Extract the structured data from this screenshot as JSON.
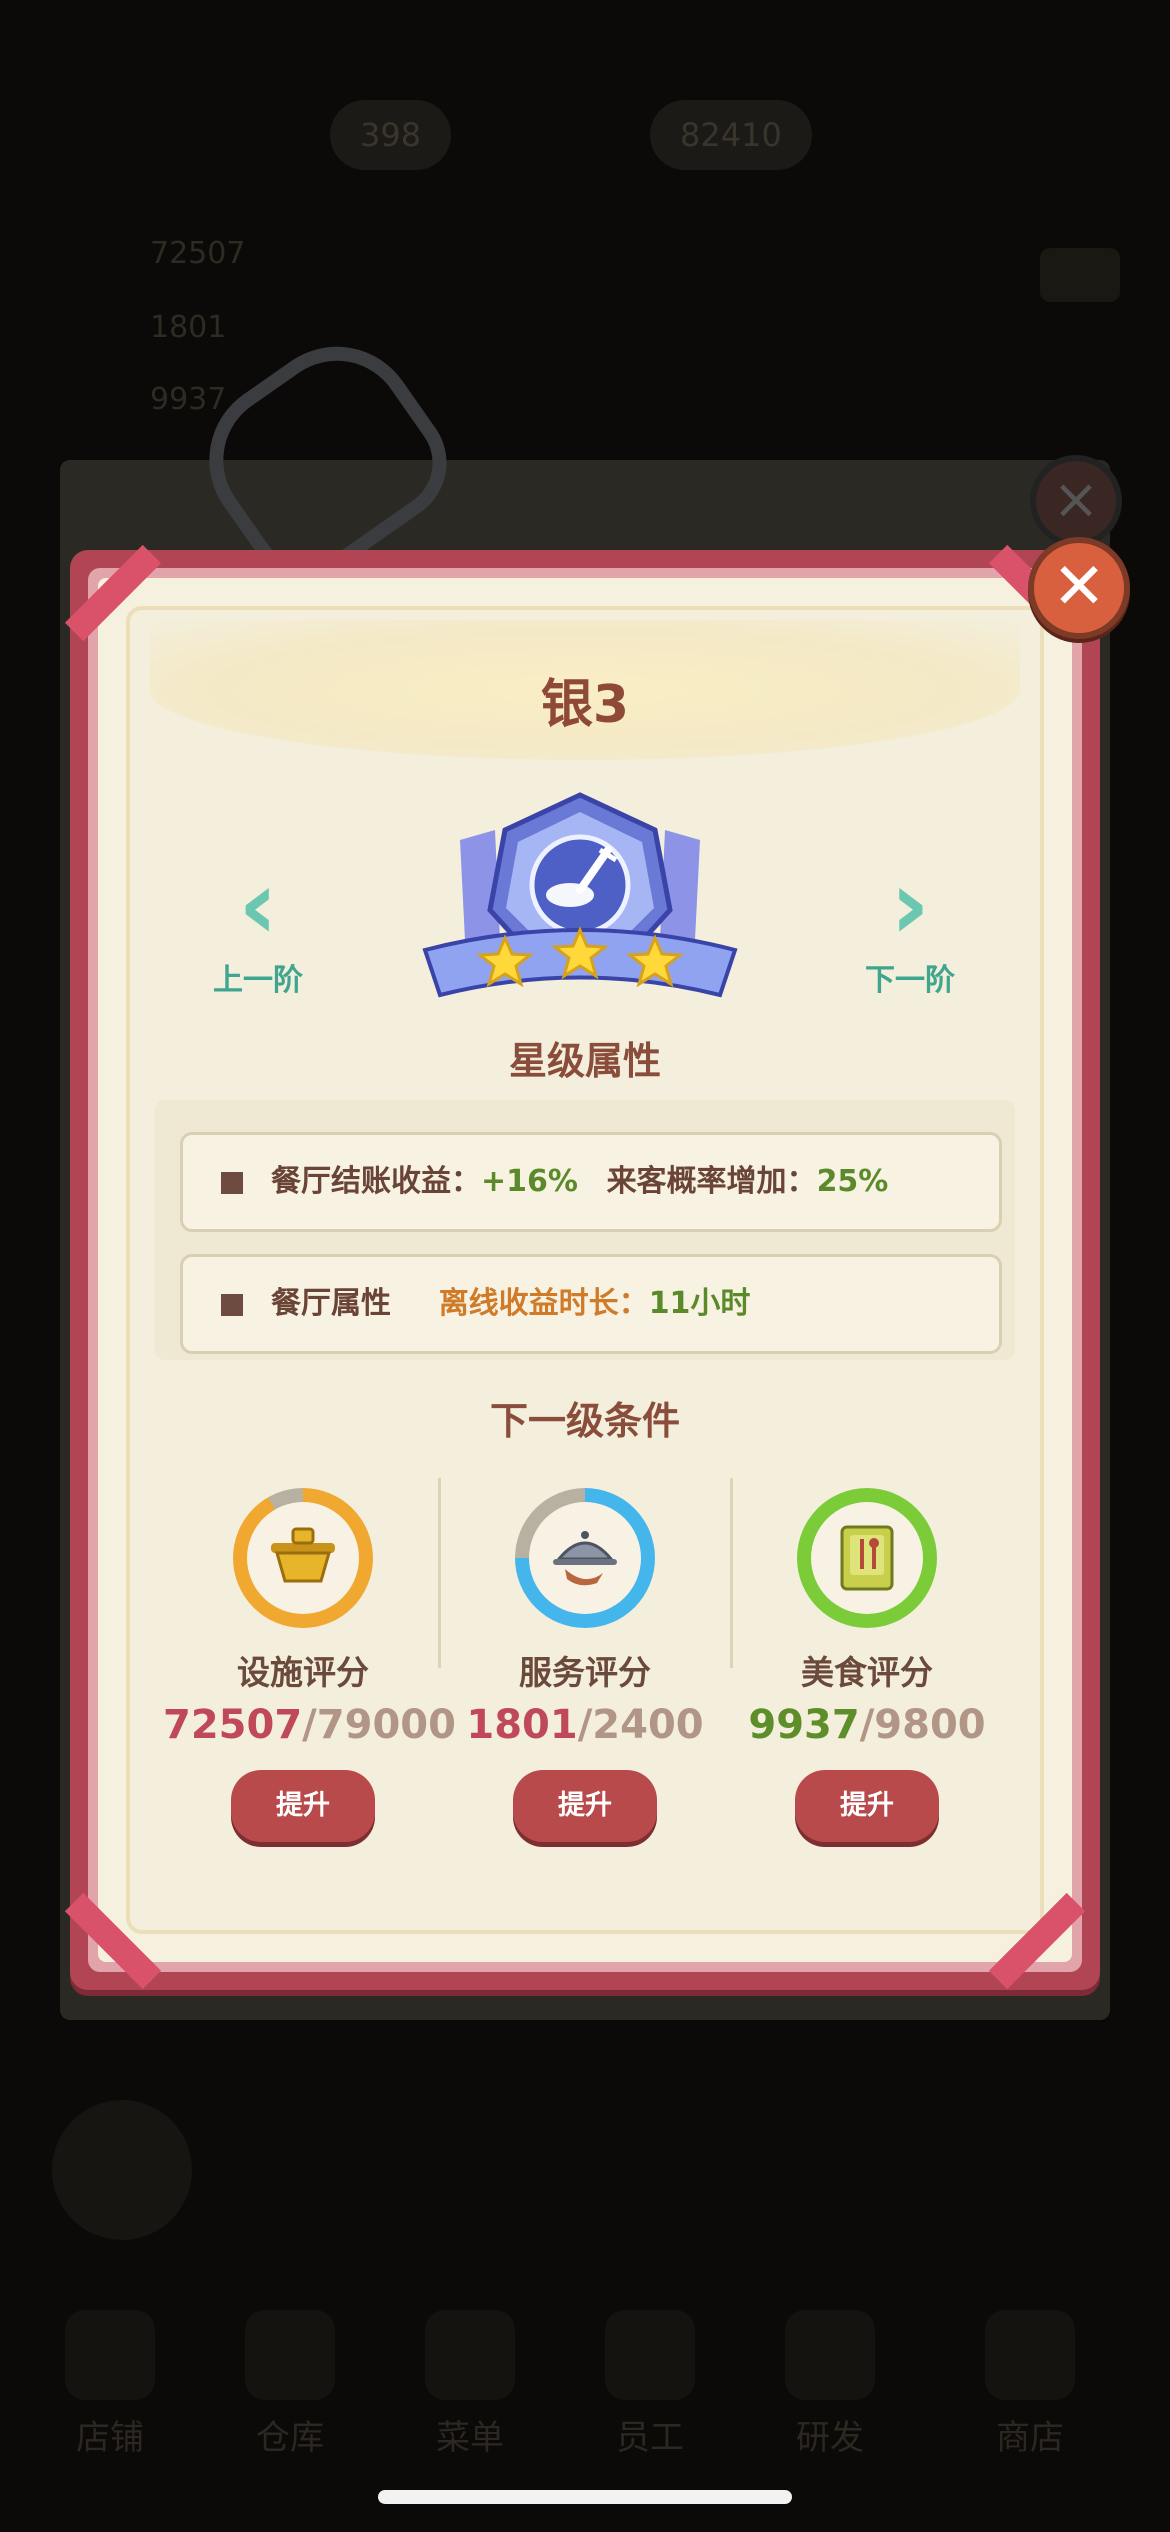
{
  "background": {
    "top_counts": [
      "398",
      "82410"
    ],
    "side_stats": [
      "72507",
      "1801",
      "9937"
    ],
    "nav": [
      "店铺",
      "仓库",
      "菜单",
      "员工",
      "研发",
      "商店"
    ]
  },
  "panel": {
    "title": "银3",
    "close_label": "✕",
    "prev_label": "上一阶",
    "next_label": "下一阶",
    "stars": 3,
    "star_attr_title": "星级属性",
    "attributes": [
      {
        "label": "餐厅结账收益：",
        "value": "+16%",
        "label2": "来客概率增加：",
        "value2": "25%"
      },
      {
        "label": "餐厅属性",
        "label2": "离线收益时长：",
        "value2": "11小时"
      }
    ],
    "next_cond_title": "下一级条件",
    "conditions": [
      {
        "label": "设施评分",
        "current": "72507",
        "target": "/79000",
        "progress": 0.918,
        "ring_color": "#f0a830",
        "icon": "golden-pot-icon",
        "button": "提升"
      },
      {
        "label": "服务评分",
        "current": "1801",
        "target": "/2400",
        "progress": 0.75,
        "ring_color": "#45b6ec",
        "icon": "waiter-cloche-icon",
        "button": "提升"
      },
      {
        "label": "美食评分",
        "current": "9937",
        "target": "/9800",
        "progress": 1.0,
        "ring_color": "#7ccc3a",
        "icon": "recipe-book-icon",
        "button": "提升"
      }
    ]
  }
}
